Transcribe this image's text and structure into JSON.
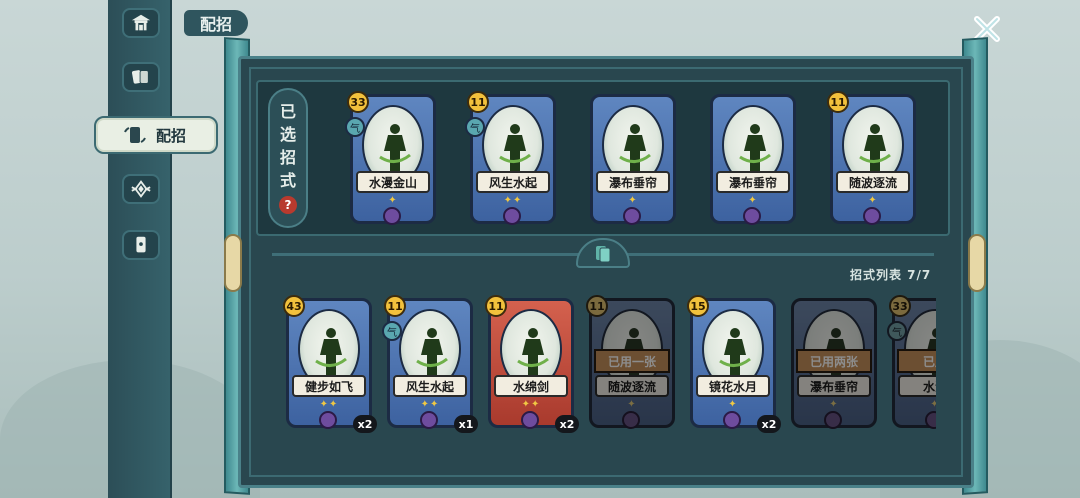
{
  "page_title": "配招",
  "nav": {
    "items": [
      {
        "icon": "pavilion-icon"
      },
      {
        "icon": "cards-icon"
      },
      {
        "icon": "deck-swap-icon",
        "label": "配招",
        "active": true
      },
      {
        "icon": "emblem-icon"
      },
      {
        "icon": "card-hand-icon"
      }
    ]
  },
  "selected": {
    "label_chars": [
      "已",
      "选",
      "招",
      "式"
    ],
    "help_symbol": "?",
    "cards": [
      {
        "name": "水漫金山",
        "cost": "33",
        "type": "气",
        "stars": "✦",
        "color": "blue"
      },
      {
        "name": "风生水起",
        "cost": "11",
        "type": "气",
        "stars": "✦✦",
        "color": "blue"
      },
      {
        "name": "瀑布垂帘",
        "cost": "",
        "type": "",
        "stars": "✦",
        "color": "blue"
      },
      {
        "name": "瀑布垂帘",
        "cost": "",
        "type": "",
        "stars": "✦",
        "color": "blue"
      },
      {
        "name": "随波逐流",
        "cost": "11",
        "type": "",
        "stars": "✦",
        "color": "blue"
      }
    ]
  },
  "list": {
    "header": "招式列表 7/7",
    "cards": [
      {
        "name": "健步如飞",
        "cost": "43",
        "type": "",
        "stars": "✦✦",
        "color": "blue",
        "count": "x2",
        "used": ""
      },
      {
        "name": "风生水起",
        "cost": "11",
        "type": "气",
        "stars": "✦✦",
        "color": "blue",
        "count": "x1",
        "used": ""
      },
      {
        "name": "水绵剑",
        "cost": "11",
        "type": "",
        "stars": "✦✦",
        "color": "red",
        "count": "x2",
        "used": ""
      },
      {
        "name": "随波逐流",
        "cost": "11",
        "type": "",
        "stars": "✦",
        "color": "blue",
        "count": "",
        "used": "已用一张"
      },
      {
        "name": "镜花水月",
        "cost": "15",
        "type": "",
        "stars": "✦",
        "color": "blue",
        "count": "x2",
        "used": ""
      },
      {
        "name": "瀑布垂帘",
        "cost": "",
        "type": "",
        "stars": "✦",
        "color": "blue",
        "count": "",
        "used": "已用两张"
      },
      {
        "name": "水漫",
        "cost": "33",
        "type": "气",
        "stars": "✦",
        "color": "blue",
        "count": "",
        "used": "已用"
      }
    ]
  },
  "colors": {
    "accent": "#4a8189",
    "panel": "#29474f",
    "card_blue": "#4c73b0",
    "card_red": "#c24f3e",
    "used_tag": "#e38a33"
  }
}
